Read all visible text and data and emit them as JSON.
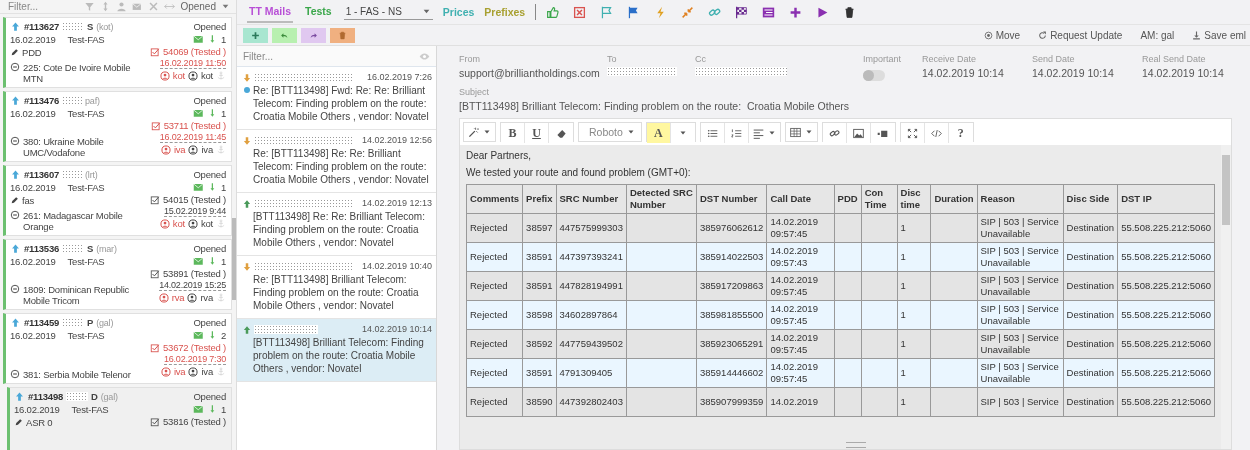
{
  "left_panel": {
    "filter": {
      "placeholder": "Filter..."
    },
    "status_filter": "Opened",
    "tickets": [
      {
        "id": "#113627",
        "suffix": "S",
        "user": "(kot)",
        "status": "Opened",
        "date": "16.02.2019",
        "type": "Test-FAS",
        "mail_count": "1",
        "note": "PDD",
        "test": "54069 (Tested )",
        "test_time": "16.02.2019 11:50",
        "overdue": true,
        "route": "225: Cote De Ivoire Mobile MTN",
        "assignees": [
          "kot",
          "kot"
        ],
        "selected": false
      },
      {
        "id": "#113476",
        "user": "paf)",
        "status": "Opened",
        "date": "16.02.2019",
        "type": "Test-FAS",
        "mail_count": "1",
        "test": "53711 (Tested )",
        "test_time": "16.02.2019 11:45",
        "overdue": true,
        "route": "380: Ukraine Mobile UMC/Vodafone",
        "assignees": [
          "iva",
          "iva"
        ],
        "selected": false
      },
      {
        "id": "#113607",
        "user": "(lrt)",
        "status": "Opened",
        "date": "16.02.2019",
        "type": "Test-FAS",
        "mail_count": "1",
        "note": "fas",
        "test": "54015 (Tested )",
        "test_time": "15.02.2019 9:44",
        "overdue": false,
        "route": "261: Madagascar Mobile Orange",
        "assignees": [
          "kot",
          "kot"
        ],
        "selected": false
      },
      {
        "id": "#113536",
        "suffix": "S",
        "user": "(mar)",
        "status": "Opened",
        "date": "16.02.2019",
        "type": "Test-FAS",
        "mail_count": "1",
        "test": "53891 (Tested )",
        "test_time": "14.02.2019 15:25",
        "overdue": false,
        "route": "1809: Dominican Republic Mobile Tricom",
        "assignees": [
          "rva",
          "rva"
        ],
        "selected": false
      },
      {
        "id": "#113459",
        "suffix": "P",
        "user": "(gal)",
        "status": "Opened",
        "date": "16.02.2019",
        "type": "Test-FAS",
        "mail_count": "2",
        "test": "53672 (Tested )",
        "test_time": "16.02.2019 7:30",
        "overdue": true,
        "route": "381: Serbia Mobile Telenor",
        "assignees": [
          "iva",
          "iva"
        ],
        "selected": false
      },
      {
        "id": "#113498",
        "suffix": "D",
        "user": "(gal)",
        "status": "Opened",
        "date": "16.02.2019",
        "type": "Test-FAS",
        "mail_count": "1",
        "note": "ASR 0",
        "test": "53816 (Tested )",
        "overdue": false,
        "selected": true
      }
    ]
  },
  "toolbar": {
    "tabs": [
      {
        "label": "TT Mails",
        "selected": true,
        "color": "#b84fd6"
      },
      {
        "label": "Tests",
        "selected": false,
        "color": "#3aa64a"
      }
    ],
    "dropdown": "1 - FAS - NS",
    "links": [
      {
        "label": "Prices",
        "color": "#3fb0b0"
      },
      {
        "label": "Prefixes",
        "color": "#a8a030"
      }
    ],
    "actions": [
      {
        "kind": "move",
        "label": "Move"
      },
      {
        "kind": "refresh",
        "label": "Request Update"
      },
      {
        "kind": "plain",
        "label": "AM: gal"
      },
      {
        "kind": "download",
        "label": "Save eml"
      }
    ]
  },
  "message_list": {
    "filter": {
      "placeholder": "Filter..."
    },
    "messages": [
      {
        "kind": "incoming",
        "unread": true,
        "date": "16.02.2019 7:26",
        "subject": "Re: [BTT113498] Fwd: Re: Re: Brilliant Telecom: Finding problem on the route: Croatia Mobile Others , vendor: Novatel",
        "selected": false
      },
      {
        "kind": "incoming",
        "unread": false,
        "date": "14.02.2019 12:56",
        "subject": "Re: [BTT113498] Re: Re: Brilliant Telecom: Finding problem on the route: Croatia Mobile Others , vendor: Novatel",
        "selected": false
      },
      {
        "kind": "outgoing",
        "unread": false,
        "date": "14.02.2019 12:13",
        "subject": "[BTT113498] Re: Re: Brilliant Telecom: Finding problem on the route: Croatia Mobile Others , vendor: Novatel",
        "selected": false
      },
      {
        "kind": "incoming",
        "unread": false,
        "date": "14.02.2019 10:40",
        "subject": "Re: [BTT113498] Brilliant Telecom: Finding problem on the route: Croatia Mobile Others , vendor: Novatel",
        "selected": false
      },
      {
        "kind": "outgoing",
        "unread": false,
        "date": "14.02.2019 10:14",
        "subject": "[BTT113498] Brilliant Telecom: Finding problem on the route: Croatia Mobile Others , vendor: Novatel",
        "selected": true
      }
    ]
  },
  "mail": {
    "from_label": "From",
    "from": "support@brilliantholdings.com",
    "to_label": "To",
    "cc_label": "Cc",
    "important_label": "Important",
    "important": false,
    "dates": [
      {
        "label": "Receive Date",
        "value": "14.02.2019 10:14"
      },
      {
        "label": "Send Date",
        "value": "14.02.2019 10:14"
      },
      {
        "label": "Real Send Date",
        "value": "14.02.2019 10:14"
      }
    ],
    "subject_label": "Subject",
    "subject": "[BTT113498] Brilliant Telecom: Finding problem on the route:  Croatia Mobile Others",
    "editor": {
      "bold": "B",
      "underline": "U",
      "font": "Roboto",
      "highlight": "A",
      "help": "?",
      "paragraphs": [
        "Dear Partners,",
        "We tested your route and found problem (GMT+0):"
      ],
      "table": {
        "columns": [
          "Comments",
          "Prefix",
          "SRC Number",
          "Detected SRC Number",
          "DST Number",
          "Call Date",
          "PDD",
          "Con Time",
          "Disc time",
          "Duration",
          "Reason",
          "Disc Side",
          "DST IP"
        ],
        "rows": [
          [
            "Rejected",
            "38597",
            "447575999303",
            "",
            "385976062612",
            "14.02.2019 09:57:45",
            "",
            "",
            "1",
            "",
            "SIP | 503 | Service Unavailable",
            "Destination",
            "55.508.225.212:5060"
          ],
          [
            "Rejected",
            "38591",
            "447397393241",
            "",
            "385914022503",
            "14.02.2019 09:57:43",
            "",
            "",
            "1",
            "",
            "SIP | 503 | Service Unavailable",
            "Destination",
            "55.508.225.212:5060"
          ],
          [
            "Rejected",
            "38591",
            "447828194991",
            "",
            "385917209863",
            "14.02.2019 09:57:45",
            "",
            "",
            "1",
            "",
            "SIP | 503 | Service Unavailable",
            "Destination",
            "55.508.225.212:5060"
          ],
          [
            "Rejected",
            "38598",
            "34602897864",
            "",
            "385981855500",
            "14.02.2019 09:57:45",
            "",
            "",
            "1",
            "",
            "SIP | 503 | Service Unavailable",
            "Destination",
            "55.508.225.212:5060"
          ],
          [
            "Rejected",
            "38592",
            "447759439502",
            "",
            "385923065291",
            "14.02.2019 09:57:45",
            "",
            "",
            "1",
            "",
            "SIP | 503 | Service Unavailable",
            "Destination",
            "55.508.225.212:5060"
          ],
          [
            "Rejected",
            "38591",
            "4791309405",
            "",
            "385914446602",
            "14.02.2019 09:57:45",
            "",
            "",
            "1",
            "",
            "SIP | 503 | Service Unavailable",
            "Destination",
            "55.508.225.212:5060"
          ],
          [
            "Rejected",
            "38590",
            "447392802403",
            "",
            "385907999359",
            "14.02.2019",
            "",
            "",
            "1",
            "",
            "SIP | 503 | Service",
            "Destination",
            "55.508.225.212:5060"
          ]
        ]
      }
    }
  }
}
